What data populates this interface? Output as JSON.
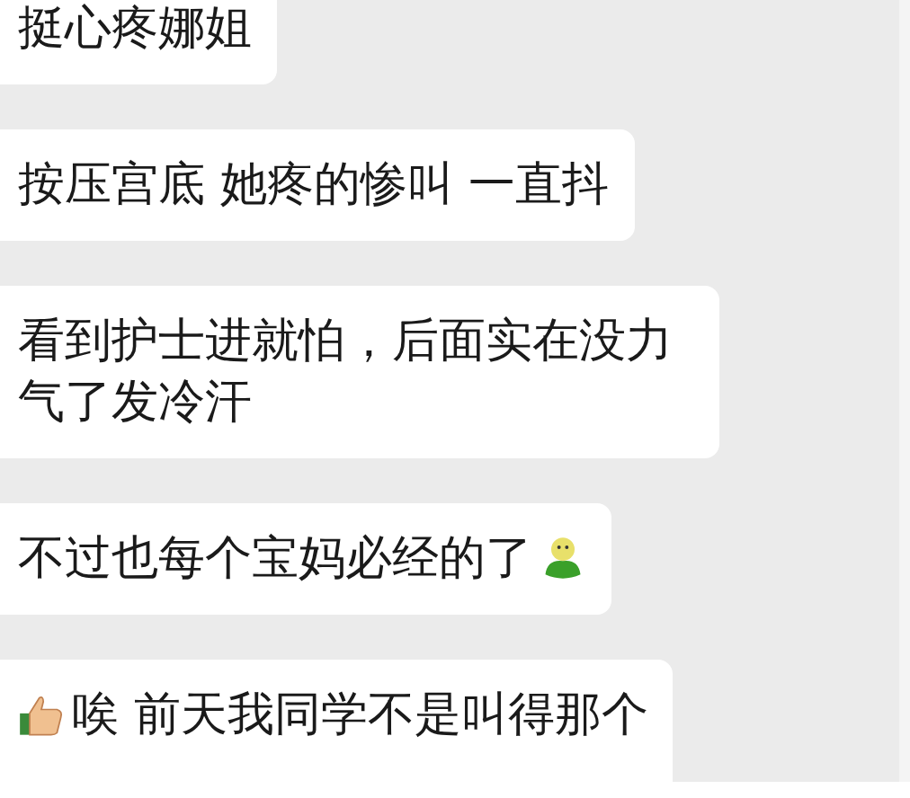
{
  "messages": [
    {
      "kind": "text",
      "text": "挺心疼娜姐"
    },
    {
      "kind": "text",
      "text": "按压宫底 她疼的惨叫 一直抖"
    },
    {
      "kind": "text",
      "text": "看到护士进就怕，后面实在没力气了发冷汗"
    },
    {
      "kind": "trailing-icon",
      "text": "不过也每个宝妈必经的了"
    },
    {
      "kind": "leading-icon",
      "text": "唉 前天我同学不是叫得那个"
    }
  ]
}
